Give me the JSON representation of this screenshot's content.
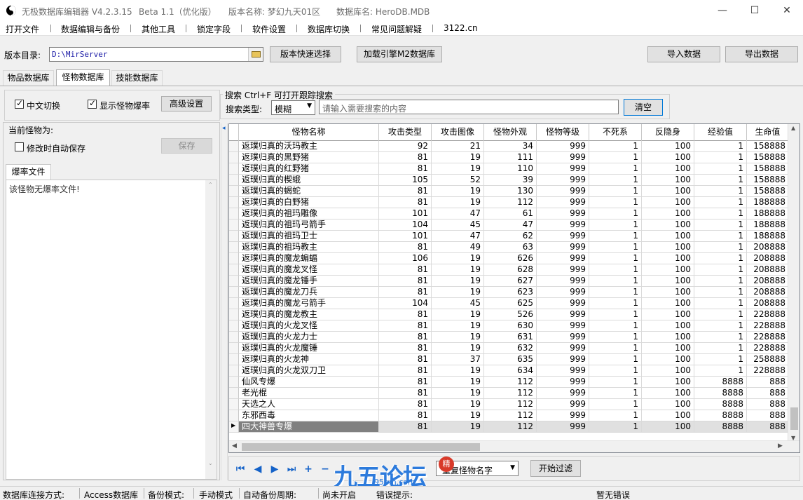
{
  "window": {
    "title_segments": [
      "无极数据库编辑器 V4.2.3.15",
      "Beta 1.1（优化版）",
      "版本名称: 梦幻九天01区",
      "数据库名: HeroDB.MDB"
    ],
    "minimize": "—",
    "maximize": "☐",
    "close": "✕"
  },
  "menu": [
    "打开文件",
    "数据编辑与备份",
    "其他工具",
    "锁定字段",
    "软件设置",
    "数据库切换",
    "常见问题解疑",
    "3122.cn"
  ],
  "toolbar": {
    "dir_label": "版本目录:",
    "dir_value": "D:\\MirServer",
    "quick_select": "版本快速选择",
    "load_engine": "加载引擎M2数据库",
    "import": "导入数据",
    "export": "导出数据"
  },
  "tabs": [
    "物品数据库",
    "怪物数据库",
    "技能数据库"
  ],
  "options": {
    "chinese_toggle": "中文切换",
    "show_drops": "显示怪物爆率",
    "advanced": "高级设置"
  },
  "search": {
    "group_title": "搜索  Ctrl+F 可打开跟踪搜索",
    "type_label": "搜索类型:",
    "type_value": "模糊",
    "placeholder": "请输入需要搜索的内容",
    "clear": "清空"
  },
  "left": {
    "current_label": "当前怪物为:",
    "autosave_label": "修改时自动保存",
    "save_button": "保存",
    "drop_tab": "爆率文件",
    "drop_text": "该怪物无爆率文件!"
  },
  "grid": {
    "columns": [
      "怪物名称",
      "攻击类型",
      "攻击图像",
      "怪物外观",
      "怪物等级",
      "不死系",
      "反隐身",
      "经验值",
      "生命值"
    ],
    "rows": [
      [
        "返璞归真的沃玛教主",
        "92",
        "21",
        "34",
        "999",
        "1",
        "100",
        "1",
        "158888"
      ],
      [
        "返璞归真的黑野猪",
        "81",
        "19",
        "111",
        "999",
        "1",
        "100",
        "1",
        "158888"
      ],
      [
        "返璞归真的红野猪",
        "81",
        "19",
        "110",
        "999",
        "1",
        "100",
        "1",
        "158888"
      ],
      [
        "返璞归真的楔蛾",
        "105",
        "52",
        "39",
        "999",
        "1",
        "100",
        "1",
        "158888"
      ],
      [
        "返璞归真的蝎蛇",
        "81",
        "19",
        "130",
        "999",
        "1",
        "100",
        "1",
        "158888"
      ],
      [
        "返璞归真的白野猪",
        "81",
        "19",
        "112",
        "999",
        "1",
        "100",
        "1",
        "188888"
      ],
      [
        "返璞归真的祖玛雕像",
        "101",
        "47",
        "61",
        "999",
        "1",
        "100",
        "1",
        "188888"
      ],
      [
        "返璞归真的祖玛弓箭手",
        "104",
        "45",
        "47",
        "999",
        "1",
        "100",
        "1",
        "188888"
      ],
      [
        "返璞归真的祖玛卫士",
        "101",
        "47",
        "62",
        "999",
        "1",
        "100",
        "1",
        "188888"
      ],
      [
        "返璞归真的祖玛教主",
        "81",
        "49",
        "63",
        "999",
        "1",
        "100",
        "1",
        "208888"
      ],
      [
        "返璞归真的魔龙蝙蝠",
        "106",
        "19",
        "626",
        "999",
        "1",
        "100",
        "1",
        "208888"
      ],
      [
        "返璞归真的魔龙叉怪",
        "81",
        "19",
        "628",
        "999",
        "1",
        "100",
        "1",
        "208888"
      ],
      [
        "返璞归真的魔龙锤手",
        "81",
        "19",
        "627",
        "999",
        "1",
        "100",
        "1",
        "208888"
      ],
      [
        "返璞归真的魔龙刀兵",
        "81",
        "19",
        "623",
        "999",
        "1",
        "100",
        "1",
        "208888"
      ],
      [
        "返璞归真的魔龙弓箭手",
        "104",
        "45",
        "625",
        "999",
        "1",
        "100",
        "1",
        "208888"
      ],
      [
        "返璞归真的魔龙教主",
        "81",
        "19",
        "526",
        "999",
        "1",
        "100",
        "1",
        "228888"
      ],
      [
        "返璞归真的火龙叉怪",
        "81",
        "19",
        "630",
        "999",
        "1",
        "100",
        "1",
        "228888"
      ],
      [
        "返璞归真的火龙力士",
        "81",
        "19",
        "631",
        "999",
        "1",
        "100",
        "1",
        "228888"
      ],
      [
        "返璞归真的火龙魔锤",
        "81",
        "19",
        "632",
        "999",
        "1",
        "100",
        "1",
        "228888"
      ],
      [
        "返璞归真的火龙神",
        "81",
        "37",
        "635",
        "999",
        "1",
        "100",
        "1",
        "258888"
      ],
      [
        "返璞归真的火龙双刀卫",
        "81",
        "19",
        "634",
        "999",
        "1",
        "100",
        "1",
        "228888"
      ],
      [
        "仙风专爆",
        "81",
        "19",
        "112",
        "999",
        "1",
        "100",
        "8888",
        "888"
      ],
      [
        "老光棍",
        "81",
        "19",
        "112",
        "999",
        "1",
        "100",
        "8888",
        "888"
      ],
      [
        "天选之人",
        "81",
        "19",
        "112",
        "999",
        "1",
        "100",
        "8888",
        "888"
      ],
      [
        "东邪西毒",
        "81",
        "19",
        "112",
        "999",
        "1",
        "100",
        "8888",
        "888"
      ],
      [
        "四大神兽专爆",
        "81",
        "19",
        "112",
        "999",
        "1",
        "100",
        "8888",
        "888"
      ]
    ]
  },
  "filter": {
    "field_value": "重复怪物名字",
    "start": "开始过滤"
  },
  "status": {
    "conn_label": "数据库连接方式:",
    "conn_value": "Access数据库",
    "backup_label": "备份模式:",
    "backup_value": "手动模式",
    "auto_label": "自动备份周期:",
    "auto_value": "尚未开启",
    "error_label": "错误提示:",
    "error_value": "暂无错误"
  },
  "watermark": {
    "text": "九五论坛",
    "url": "95bm.com",
    "badge": "精"
  },
  "colors": {
    "selected_row": "#808080",
    "accent_blue": "#1462c8"
  }
}
